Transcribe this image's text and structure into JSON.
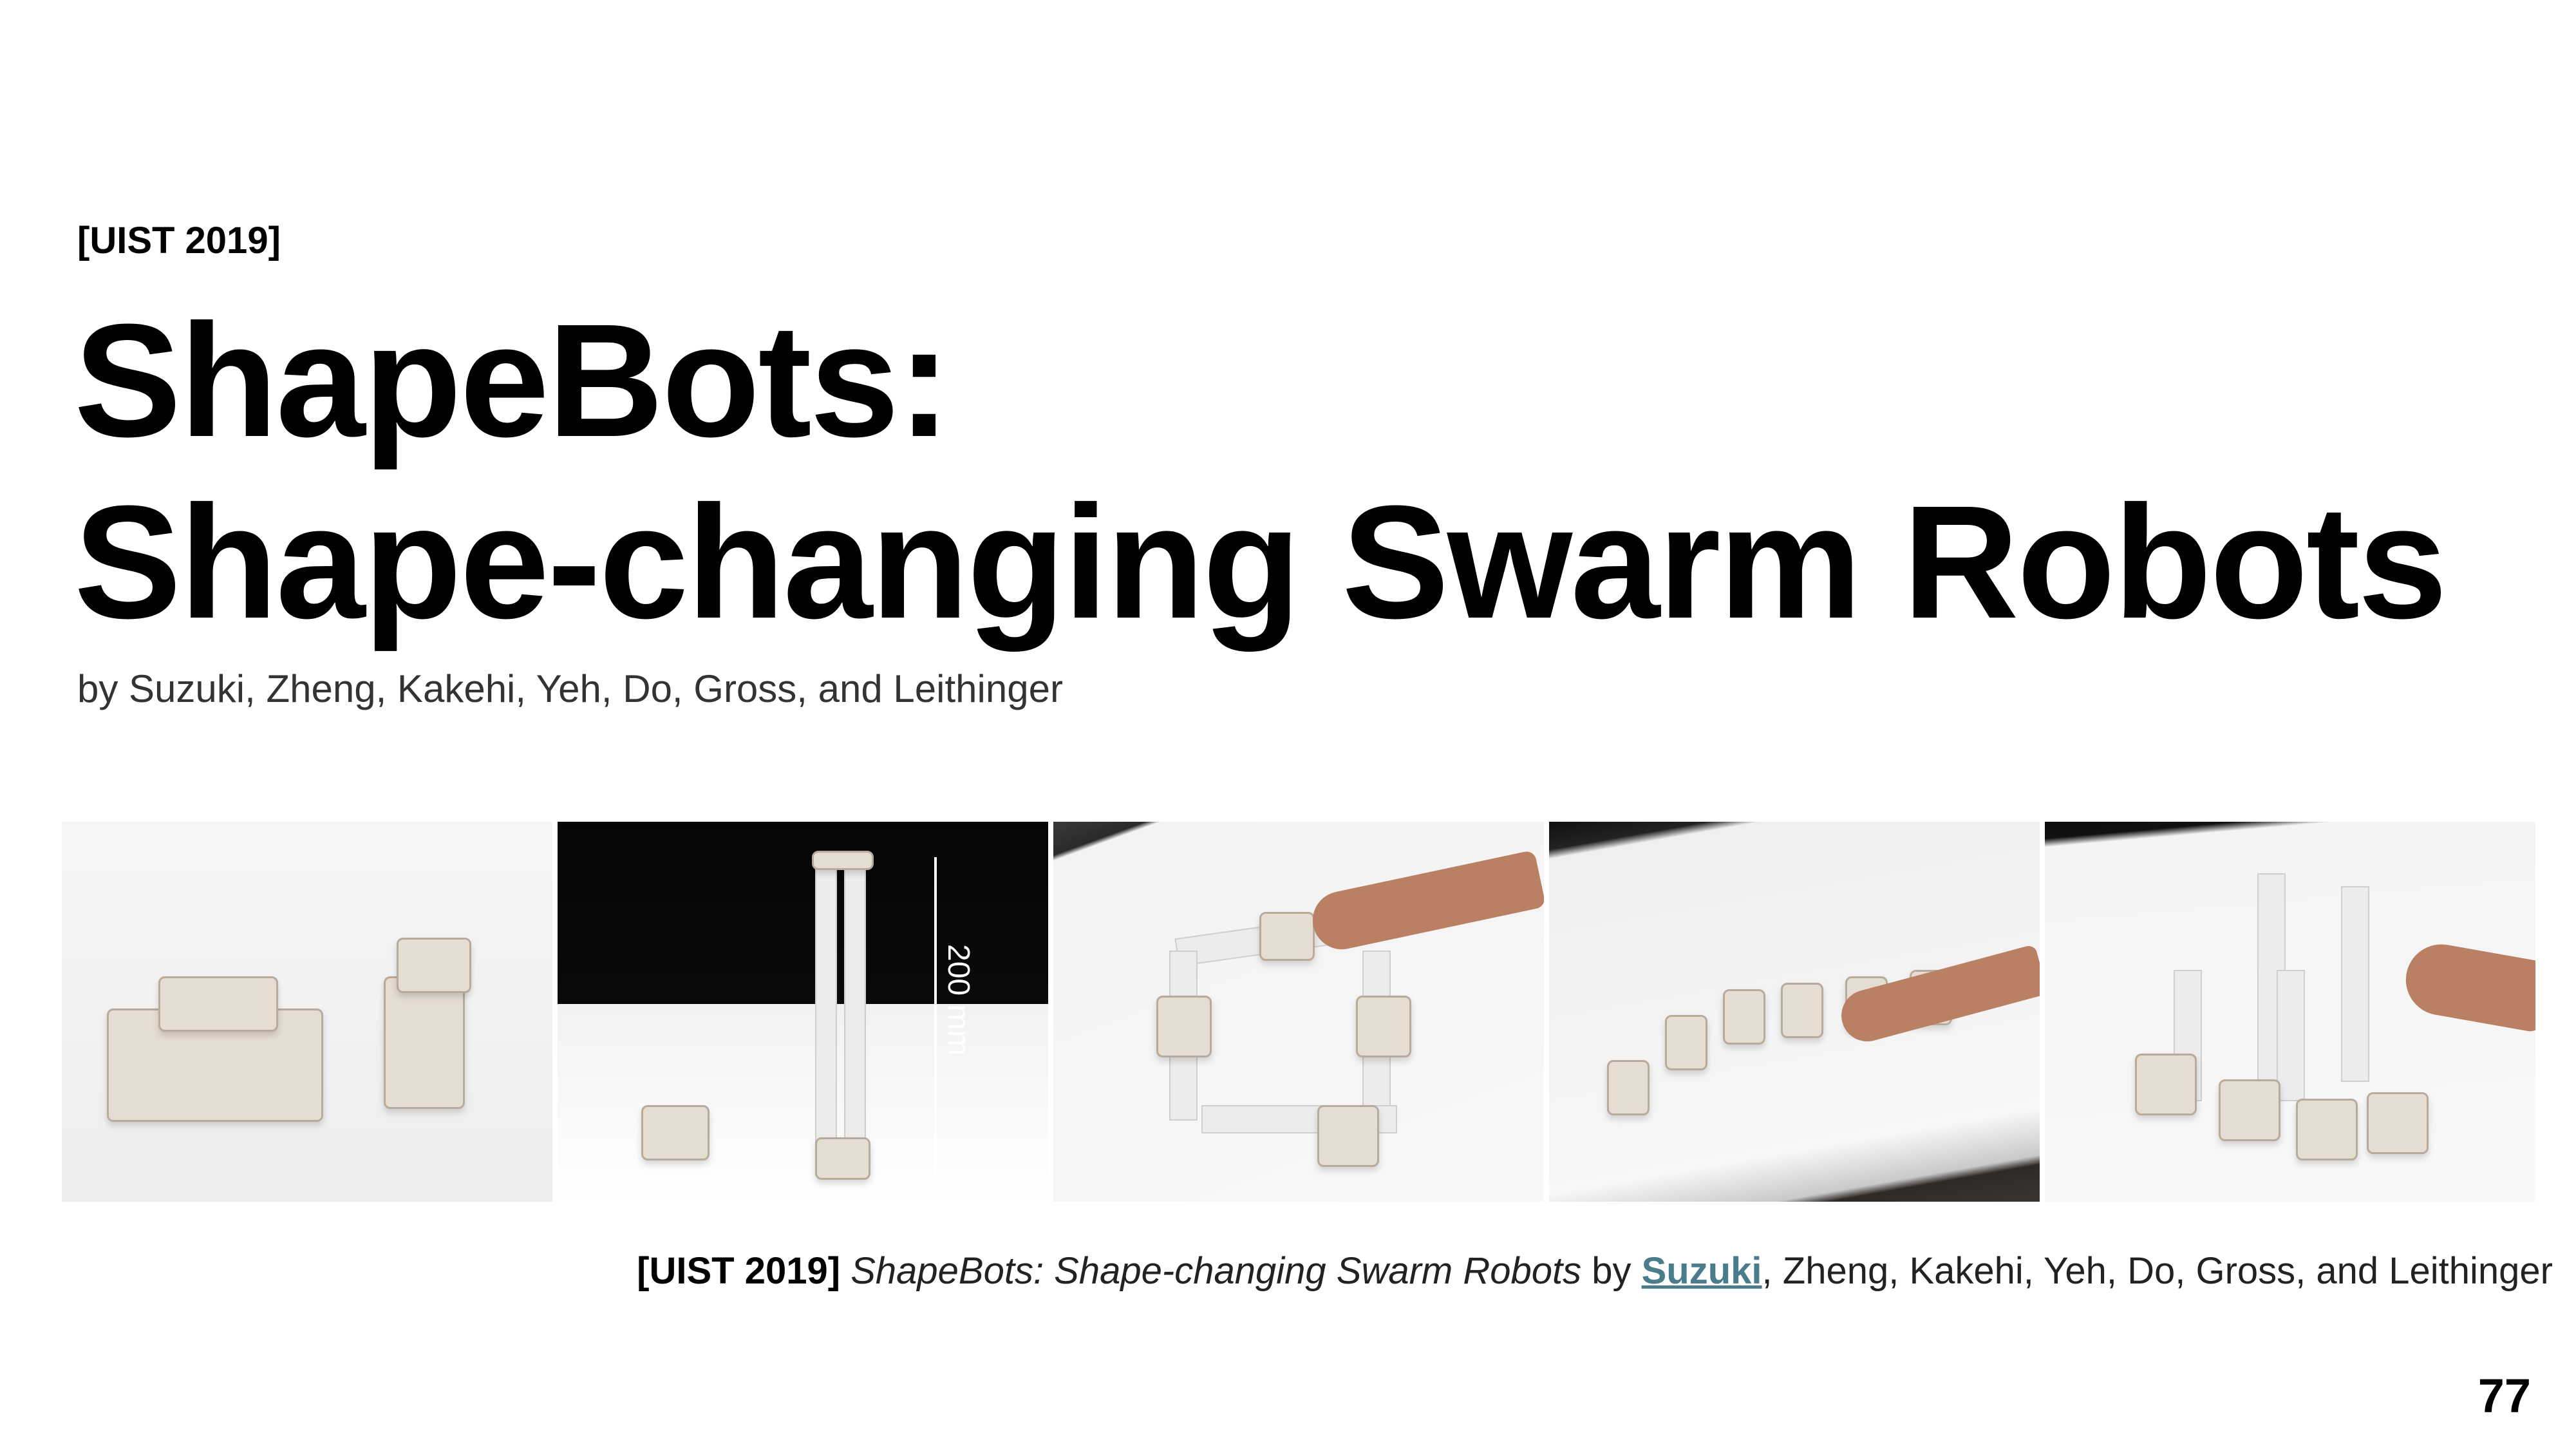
{
  "slide": {
    "venue": "[UIST 2019]",
    "title_line1": "ShapeBots:",
    "title_line2": "Shape-changing Swarm Robots",
    "authors": "by Suzuki, Zheng, Kakehi, Yeh, Do, Gross, and Leithinger",
    "page_number": "77"
  },
  "photos": {
    "scale_label": "200 mm"
  },
  "caption": {
    "venue": "[UIST 2019]",
    "title": "ShapeBots: Shape-changing Swarm Robots",
    "by": "by",
    "author_link": "Suzuki",
    "rest": ", Zheng, Kakehi, Yeh, Do, Gross, and Leithinger"
  },
  "colors": {
    "link": "#4a7c8c",
    "text": "#000000"
  }
}
